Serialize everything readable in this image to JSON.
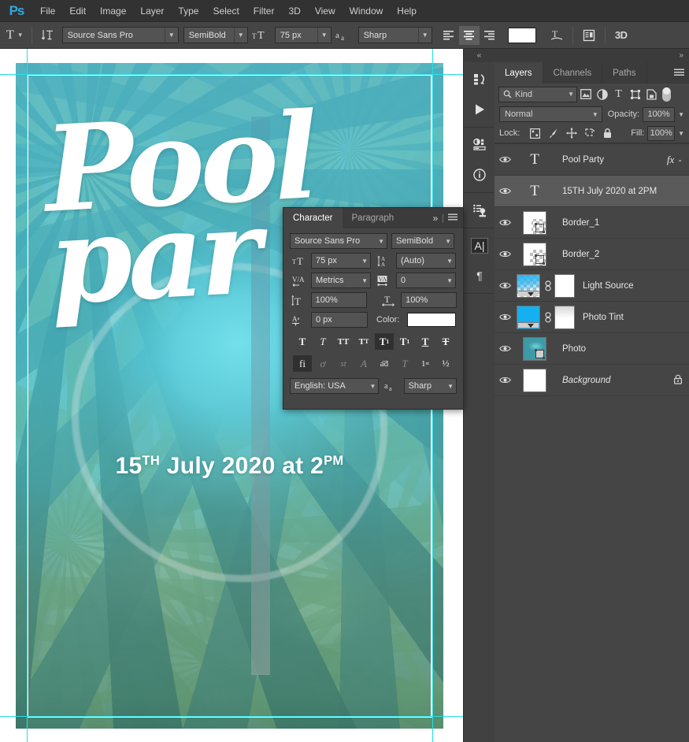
{
  "app": {
    "logo": "Ps"
  },
  "menubar": {
    "items": [
      "File",
      "Edit",
      "Image",
      "Layer",
      "Type",
      "Select",
      "Filter",
      "3D",
      "View",
      "Window",
      "Help"
    ]
  },
  "options_bar": {
    "tool_icon": "type-tool-icon",
    "orientation_icon": "toggle-text-orientation-icon",
    "font_family": "Source Sans Pro",
    "font_style": "SemiBold",
    "size_icon": "font-size-icon",
    "font_size": "75 px",
    "antialias_icon": "anti-aliasing-icon",
    "antialias": "Sharp",
    "align_left": "align-left-icon",
    "align_center": "align-center-icon",
    "align_right": "align-right-icon",
    "color_swatch": "#ffffff",
    "warp_icon": "create-warped-text-icon",
    "panels_icon": "toggle-character-paragraph-panels-icon",
    "threed_label": "3D"
  },
  "canvas": {
    "poster_title": "Pool\npar",
    "date_prefix": "15",
    "date_sup": "TH",
    "date_mid": " July 2020 at 2",
    "date_sup2": "PM"
  },
  "dock": {
    "collapse_icon": "collapse-panels-icon",
    "items": [
      {
        "name": "history-icon",
        "glyph": "history"
      },
      {
        "name": "actions-play-icon",
        "glyph": "play"
      },
      {
        "name": "adjustments-icon",
        "glyph": "adjust"
      },
      {
        "name": "info-icon",
        "glyph": "info"
      },
      {
        "name": "styles-icon",
        "glyph": "styles"
      },
      {
        "name": "character-panel-icon",
        "glyph": "A|"
      },
      {
        "name": "paragraph-panel-icon",
        "glyph": "¶"
      }
    ]
  },
  "layers_panel": {
    "collapse_icon": "collapse-panels-icon",
    "tabs": [
      {
        "label": "Layers",
        "active": true
      },
      {
        "label": "Channels",
        "active": false
      },
      {
        "label": "Paths",
        "active": false
      }
    ],
    "menu_icon": "panel-menu-icon",
    "filter": {
      "kind_label": "Kind",
      "search_icon": "search-icon",
      "icons": [
        "pixel-layer-filter-icon",
        "adjustment-layer-filter-icon",
        "type-layer-filter-icon",
        "shape-layer-filter-icon",
        "smart-object-filter-icon"
      ],
      "toggle_icon": "filter-toggle-switch"
    },
    "blend_mode": "Normal",
    "opacity_label": "Opacity:",
    "opacity_value": "100%",
    "lock_label": "Lock:",
    "lock_icons": [
      "lock-transparent-pixels-icon",
      "lock-image-pixels-icon",
      "lock-position-icon",
      "lock-artboard-nesting-icon",
      "lock-all-icon"
    ],
    "fill_label": "Fill:",
    "fill_value": "100%",
    "layers": [
      {
        "name": "Pool  Party",
        "type": "text",
        "visible": true,
        "selected": false,
        "has_fx": true,
        "locked": false,
        "italic": false
      },
      {
        "name": "15TH July 2020 at 2PM",
        "type": "text-edit",
        "visible": true,
        "selected": true,
        "has_fx": false,
        "locked": false,
        "italic": false
      },
      {
        "name": "Border_1",
        "type": "shape",
        "visible": true,
        "selected": false,
        "has_fx": false,
        "locked": false,
        "italic": false
      },
      {
        "name": "Border_2",
        "type": "shape",
        "visible": true,
        "selected": false,
        "has_fx": false,
        "locked": false,
        "italic": false
      },
      {
        "name": "Light Source",
        "type": "gradient-mask",
        "visible": true,
        "selected": false,
        "has_fx": false,
        "locked": false,
        "italic": false
      },
      {
        "name": "Photo Tint",
        "type": "solid-mask",
        "visible": true,
        "selected": false,
        "has_fx": false,
        "locked": false,
        "italic": false
      },
      {
        "name": "Photo",
        "type": "smart-object",
        "visible": true,
        "selected": false,
        "has_fx": false,
        "locked": false,
        "italic": false
      },
      {
        "name": "Background",
        "type": "background",
        "visible": true,
        "selected": false,
        "has_fx": false,
        "locked": true,
        "italic": true
      }
    ]
  },
  "character_panel": {
    "tabs": [
      {
        "label": "Character",
        "active": true
      },
      {
        "label": "Paragraph",
        "active": false
      }
    ],
    "expand_icon": "expand-icon",
    "menu_icon": "panel-menu-icon",
    "font_family": "Source Sans Pro",
    "font_style": "SemiBold",
    "font_size_icon": "font-size-icon",
    "font_size": "75 px",
    "leading_icon": "leading-icon",
    "leading": "(Auto)",
    "kerning_icon": "kerning-icon",
    "kerning": "Metrics",
    "tracking_icon": "tracking-icon",
    "tracking": "0",
    "vscale_icon": "vertical-scale-icon",
    "vertical_scale": "100%",
    "hscale_icon": "horizontal-scale-icon",
    "horizontal_scale": "100%",
    "baseline_icon": "baseline-shift-icon",
    "baseline_shift": "0 px",
    "color_label": "Color:",
    "color_value": "#ffffff",
    "style_buttons": [
      {
        "name": "faux-bold-button",
        "glyph": "T",
        "state": "off"
      },
      {
        "name": "faux-italic-button",
        "glyph": "T",
        "state": "off"
      },
      {
        "name": "all-caps-button",
        "glyph": "TT",
        "state": "off"
      },
      {
        "name": "small-caps-button",
        "glyph": "Tᴛ",
        "state": "off"
      },
      {
        "name": "superscript-button",
        "glyph": "T¹",
        "state": "on"
      },
      {
        "name": "subscript-button",
        "glyph": "T₁",
        "state": "off"
      },
      {
        "name": "underline-button",
        "glyph": "T̲",
        "state": "off"
      },
      {
        "name": "strikethrough-button",
        "glyph": "Ŧ",
        "state": "off"
      }
    ],
    "opentype_buttons": [
      {
        "name": "standard-ligatures-button",
        "glyph": "fi",
        "state": "on"
      },
      {
        "name": "contextual-alternates-button",
        "glyph": "ᵒ͓",
        "state": "dim"
      },
      {
        "name": "discretionary-ligatures-button",
        "glyph": "st",
        "state": "dim"
      },
      {
        "name": "swash-button",
        "glyph": "𝒜",
        "state": "dim"
      },
      {
        "name": "stylistic-alternates-button",
        "glyph": "ād",
        "state": "off"
      },
      {
        "name": "titling-alternates-button",
        "glyph": "T",
        "state": "dim"
      },
      {
        "name": "ordinals-button",
        "glyph": "1st",
        "state": "off"
      },
      {
        "name": "fractions-button",
        "glyph": "½",
        "state": "off"
      }
    ],
    "language": "English: USA",
    "antialias_icon": "anti-aliasing-icon",
    "antialias": "Sharp"
  },
  "colors": {
    "accent": "#31a8e0",
    "guide": "#21e0e8",
    "panel_bg": "#454545",
    "panel_dark": "#3b3b3b",
    "selected_layer": "#5a5a5a"
  }
}
